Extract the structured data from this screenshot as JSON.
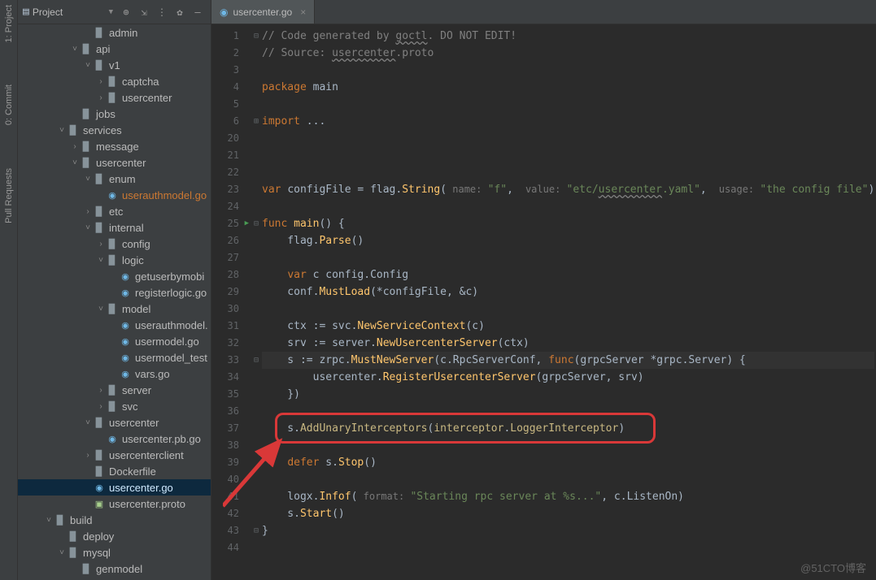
{
  "leftRail": {
    "items": [
      "1: Project",
      "0: Commit",
      "Pull Requests"
    ]
  },
  "sidebar": {
    "title": "Project",
    "toolIcons": [
      "target",
      "expand",
      "divider",
      "gear",
      "hide"
    ]
  },
  "tree": [
    {
      "depth": 5,
      "chev": "",
      "icon": "folder",
      "label": "admin"
    },
    {
      "depth": 4,
      "chev": "v",
      "icon": "folder",
      "label": "api"
    },
    {
      "depth": 5,
      "chev": "v",
      "icon": "folder",
      "label": "v1"
    },
    {
      "depth": 6,
      "chev": ">",
      "icon": "folder",
      "label": "captcha"
    },
    {
      "depth": 6,
      "chev": ">",
      "icon": "folder",
      "label": "usercenter"
    },
    {
      "depth": 4,
      "chev": "",
      "icon": "folder",
      "label": "jobs"
    },
    {
      "depth": 3,
      "chev": "v",
      "icon": "folder",
      "label": "services"
    },
    {
      "depth": 4,
      "chev": ">",
      "icon": "folder",
      "label": "message"
    },
    {
      "depth": 4,
      "chev": "v",
      "icon": "folder",
      "label": "usercenter"
    },
    {
      "depth": 5,
      "chev": "v",
      "icon": "folder",
      "label": "enum"
    },
    {
      "depth": 6,
      "chev": "",
      "icon": "go",
      "label": "userauthmodel.go",
      "hl": true
    },
    {
      "depth": 5,
      "chev": ">",
      "icon": "folder",
      "label": "etc"
    },
    {
      "depth": 5,
      "chev": "v",
      "icon": "folder",
      "label": "internal"
    },
    {
      "depth": 6,
      "chev": ">",
      "icon": "folder",
      "label": "config"
    },
    {
      "depth": 6,
      "chev": "v",
      "icon": "folder",
      "label": "logic"
    },
    {
      "depth": 7,
      "chev": "",
      "icon": "go",
      "label": "getuserbymobi"
    },
    {
      "depth": 7,
      "chev": "",
      "icon": "go",
      "label": "registerlogic.go"
    },
    {
      "depth": 6,
      "chev": "v",
      "icon": "folder",
      "label": "model"
    },
    {
      "depth": 7,
      "chev": "",
      "icon": "go",
      "label": "userauthmodel."
    },
    {
      "depth": 7,
      "chev": "",
      "icon": "go",
      "label": "usermodel.go"
    },
    {
      "depth": 7,
      "chev": "",
      "icon": "go",
      "label": "usermodel_test"
    },
    {
      "depth": 7,
      "chev": "",
      "icon": "go",
      "label": "vars.go"
    },
    {
      "depth": 6,
      "chev": ">",
      "icon": "folder",
      "label": "server"
    },
    {
      "depth": 6,
      "chev": ">",
      "icon": "folder",
      "label": "svc"
    },
    {
      "depth": 5,
      "chev": "v",
      "icon": "folder",
      "label": "usercenter"
    },
    {
      "depth": 6,
      "chev": "",
      "icon": "go",
      "label": "usercenter.pb.go"
    },
    {
      "depth": 5,
      "chev": ">",
      "icon": "folder",
      "label": "usercenterclient"
    },
    {
      "depth": 5,
      "chev": "",
      "icon": "folder",
      "label": "Dockerfile"
    },
    {
      "depth": 5,
      "chev": "",
      "icon": "go",
      "label": "usercenter.go",
      "active": true
    },
    {
      "depth": 5,
      "chev": "",
      "icon": "prm",
      "label": "usercenter.proto"
    },
    {
      "depth": 2,
      "chev": "v",
      "icon": "folder",
      "label": "build"
    },
    {
      "depth": 3,
      "chev": "",
      "icon": "folder",
      "label": "deploy"
    },
    {
      "depth": 3,
      "chev": "v",
      "icon": "folder",
      "label": "mysql"
    },
    {
      "depth": 4,
      "chev": "",
      "icon": "folder",
      "label": "genmodel"
    }
  ],
  "tab": {
    "label": "usercenter.go"
  },
  "code": {
    "lineNumbers": [
      "1",
      "2",
      "3",
      "4",
      "5",
      "6",
      "20",
      "21",
      "22",
      "23",
      "24",
      "25",
      "26",
      "27",
      "28",
      "29",
      "30",
      "31",
      "32",
      "33",
      "34",
      "35",
      "36",
      "37",
      "38",
      "39",
      "40",
      "41",
      "42",
      "43",
      "44"
    ],
    "lines": {
      "l1a": "// Code generated by ",
      "l1b": "goctl",
      "l1c": ". DO NOT EDIT!",
      "l2a": "// Source: ",
      "l2b": "usercenter",
      "l2c": ".proto",
      "l4a": "package ",
      "l4b": "main",
      "l6a": "import ",
      "l6b": "...",
      "l23a": "var ",
      "l23b": "configFile",
      "l23c": " = flag.",
      "l23d": "String",
      "l23e": "(",
      "l23h1": " name: ",
      "l23s1": "\"f\"",
      "l23c1": ", ",
      "l23h2": " value: ",
      "l23s2": "\"etc/",
      "l23s2u": "usercenter",
      "l23s2b": ".yaml\"",
      "l23c2": ", ",
      "l23h3": " usage: ",
      "l23s3": "\"the config file\"",
      "l23end": ")",
      "l25a": "func ",
      "l25b": "main",
      "l25c": "() {",
      "l26a": "    flag.",
      "l26b": "Parse",
      "l26c": "()",
      "l28a": "    ",
      "l28b": "var ",
      "l28c": "c config.",
      "l28d": "Config",
      "l29a": "    conf.",
      "l29b": "MustLoad",
      "l29c": "(*configFile, &c)",
      "l31a": "    ctx := svc.",
      "l31b": "NewServiceContext",
      "l31c": "(c)",
      "l32a": "    srv := server.",
      "l32b": "NewUsercenterServer",
      "l32c": "(ctx)",
      "l33a": "    s := zrpc.",
      "l33b": "MustNewServer",
      "l33c": "(c.RpcServerConf, ",
      "l33d": "func",
      "l33e": "(grpcServer *grpc.",
      "l33f": "Server",
      "l33g": ") {",
      "l34a": "        usercenter.",
      "l34b": "RegisterUsercenterServer",
      "l34c": "(grpcServer, srv)",
      "l35a": "    })",
      "l37a": "    s.",
      "l37b": "AddUnaryInterceptors",
      "l37c": "(",
      "l37d": "interceptor",
      "l37e": ".",
      "l37f": "LoggerInterceptor",
      "l37g": ")",
      "l39a": "    ",
      "l39b": "defer ",
      "l39c": "s.",
      "l39d": "Stop",
      "l39e": "()",
      "l41a": "    logx.",
      "l41b": "Infof",
      "l41c": "(",
      "l41h": " format: ",
      "l41s": "\"Starting rpc server at %s...\"",
      "l41d": ", c.ListenOn)",
      "l42a": "    s.",
      "l42b": "Start",
      "l42c": "()",
      "l43a": "}"
    }
  },
  "watermark": "@51CTO博客"
}
